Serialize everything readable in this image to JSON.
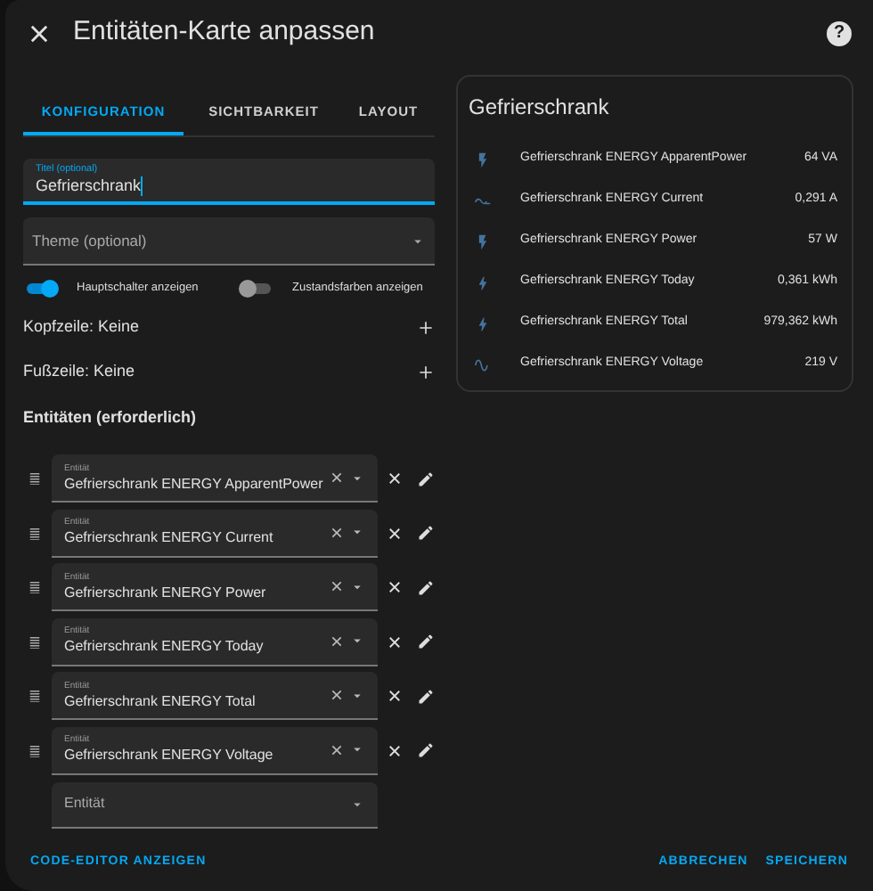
{
  "dialog": {
    "title": "Entitäten-Karte anpassen",
    "help": "?"
  },
  "tabs": [
    {
      "label": "KONFIGURATION",
      "selected": true
    },
    {
      "label": "SICHTBARKEIT",
      "selected": false
    },
    {
      "label": "LAYOUT",
      "selected": false
    }
  ],
  "title_field": {
    "label": "Titel (optional)",
    "value": "Gefrierschrank"
  },
  "theme_field": {
    "placeholder": "Theme (optional)"
  },
  "switches": [
    {
      "label": "Hauptschalter anzeigen",
      "on": true
    },
    {
      "label": "Zustandsfarben anzeigen",
      "on": false
    }
  ],
  "sections": [
    {
      "label": "Kopfzeile: Keine"
    },
    {
      "label": "Fußzeile: Keine"
    }
  ],
  "entities_heading": "Entitäten (erforderlich)",
  "entities": [
    {
      "label": "Entität",
      "value": "Gefrierschrank ENERGY ApparentPower"
    },
    {
      "label": "Entität",
      "value": "Gefrierschrank ENERGY Current"
    },
    {
      "label": "Entität",
      "value": "Gefrierschrank ENERGY Power"
    },
    {
      "label": "Entität",
      "value": "Gefrierschrank ENERGY Today"
    },
    {
      "label": "Entität",
      "value": "Gefrierschrank ENERGY Total"
    },
    {
      "label": "Entität",
      "value": "Gefrierschrank ENERGY Voltage"
    }
  ],
  "new_entity": {
    "placeholder": "Entität"
  },
  "preview": {
    "title": "Gefrierschrank",
    "rows": [
      {
        "kind": "flash",
        "name": "Gefrierschrank ENERGY ApparentPower",
        "value": "64 VA"
      },
      {
        "kind": "current",
        "name": "Gefrierschrank ENERGY Current",
        "value": "0,291 A"
      },
      {
        "kind": "flash",
        "name": "Gefrierschrank ENERGY Power",
        "value": "57 W"
      },
      {
        "kind": "bolt",
        "name": "Gefrierschrank ENERGY Today",
        "value": "0,361 kWh"
      },
      {
        "kind": "bolt",
        "name": "Gefrierschrank ENERGY Total",
        "value": "979,362 kWh"
      },
      {
        "kind": "wave",
        "name": "Gefrierschrank ENERGY Voltage",
        "value": "219 V"
      }
    ]
  },
  "footer": {
    "code_editor": "CODE-EDITOR ANZEIGEN",
    "cancel": "ABBRECHEN",
    "save": "SPEICHERN"
  }
}
